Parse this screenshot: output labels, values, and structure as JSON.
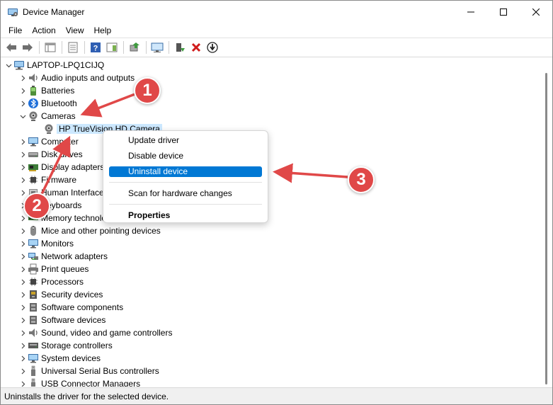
{
  "window": {
    "title": "Device Manager"
  },
  "menu": [
    "File",
    "Action",
    "View",
    "Help"
  ],
  "tree": {
    "root": "LAPTOP-LPQ1CIJQ",
    "categories": [
      {
        "label": "Audio inputs and outputs",
        "icon": "speaker-icon",
        "expanded": false
      },
      {
        "label": "Batteries",
        "icon": "battery-icon",
        "expanded": false
      },
      {
        "label": "Bluetooth",
        "icon": "bluetooth-icon",
        "expanded": false
      },
      {
        "label": "Cameras",
        "icon": "webcam-icon",
        "expanded": true,
        "children": [
          {
            "label": "HP TrueVision HD Camera",
            "icon": "webcam-icon"
          }
        ]
      },
      {
        "label": "Computer",
        "icon": "monitor-icon",
        "expanded": false
      },
      {
        "label": "Disk drives",
        "icon": "disk-icon",
        "expanded": false
      },
      {
        "label": "Display adapters",
        "icon": "display-adapter-icon",
        "expanded": false
      },
      {
        "label": "Firmware",
        "icon": "chip-icon",
        "expanded": false
      },
      {
        "label": "Human Interface Devices",
        "icon": "hid-icon",
        "expanded": false
      },
      {
        "label": "Keyboards",
        "icon": "keyboard-icon",
        "expanded": false
      },
      {
        "label": "Memory technology devices",
        "icon": "memory-icon",
        "expanded": false
      },
      {
        "label": "Mice and other pointing devices",
        "icon": "mouse-icon",
        "expanded": false
      },
      {
        "label": "Monitors",
        "icon": "monitor-icon",
        "expanded": false
      },
      {
        "label": "Network adapters",
        "icon": "network-icon",
        "expanded": false
      },
      {
        "label": "Print queues",
        "icon": "printer-icon",
        "expanded": false
      },
      {
        "label": "Processors",
        "icon": "chip-icon",
        "expanded": false
      },
      {
        "label": "Security devices",
        "icon": "security-icon",
        "expanded": false
      },
      {
        "label": "Software components",
        "icon": "component-icon",
        "expanded": false
      },
      {
        "label": "Software devices",
        "icon": "component-icon",
        "expanded": false
      },
      {
        "label": "Sound, video and game controllers",
        "icon": "speaker-icon",
        "expanded": false
      },
      {
        "label": "Storage controllers",
        "icon": "storage-icon",
        "expanded": false
      },
      {
        "label": "System devices",
        "icon": "monitor-icon",
        "expanded": false
      },
      {
        "label": "Universal Serial Bus controllers",
        "icon": "usb-icon",
        "expanded": false
      },
      {
        "label": "USB Connector Managers",
        "icon": "usb-icon",
        "expanded": false
      }
    ]
  },
  "context_menu": {
    "items": [
      "Update driver",
      "Disable device",
      "Uninstall device",
      "Scan for hardware changes",
      "Properties"
    ],
    "highlighted": "Uninstall device"
  },
  "statusbar": {
    "text": "Uninstalls the driver for the selected device."
  },
  "annotations": {
    "badges": [
      "1",
      "2",
      "3"
    ],
    "color": "#e04848"
  }
}
